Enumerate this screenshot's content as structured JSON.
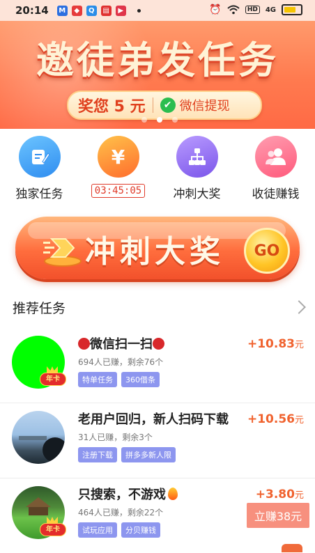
{
  "status_bar": {
    "time": "20:14",
    "network": "4G",
    "hd": "HD",
    "icons": [
      "app-m-icon",
      "app-red-icon",
      "app-q-icon",
      "app-news-icon",
      "app-video-icon",
      "alarm-icon",
      "wifi-icon",
      "battery-icon"
    ]
  },
  "banner": {
    "title": "邀徒弟发任务",
    "reward": "奖您 5 元",
    "wechat_label": "微信提现",
    "slide_index": 2,
    "slide_count": 3
  },
  "nav": {
    "items": [
      {
        "label": "独家任务",
        "icon": "edit-icon",
        "color": "#3fa6f5"
      },
      {
        "label": "03:45:05",
        "icon": "yuan-icon",
        "color": "#ff8a2a"
      },
      {
        "label": "冲刺大奖",
        "icon": "network-icon",
        "color": "#9b6cf5"
      },
      {
        "label": "收徒赚钱",
        "icon": "users-icon",
        "color": "#ff6f8a"
      }
    ]
  },
  "sprint": {
    "text": "冲刺大奖",
    "go_label": "GO"
  },
  "recommended": {
    "title": "推荐任务"
  },
  "tasks": [
    {
      "title": "微信扫一扫",
      "sub": "694人已赚，剩余76个",
      "tags": [
        "特单任务",
        "360借条"
      ],
      "price": "+10.83",
      "unit": "元",
      "badge": "年卡",
      "avatar_color": "#00ff00"
    },
    {
      "title": "老用户回归，新人扫码下载",
      "sub": "31人已赚，剩余3个",
      "tags": [
        "注册下载",
        "拼多多新人限"
      ],
      "price": "+10.56",
      "unit": "元",
      "badge": "",
      "avatar_color": "#8fb3d6"
    },
    {
      "title": "只搜索，不游戏",
      "sub": "464人已赚，剩余22个",
      "tags": [
        "试玩应用",
        "分贝赚钱"
      ],
      "price": "+3.80",
      "unit": "元",
      "badge": "年卡",
      "avatar_color": "#4cae3a"
    }
  ],
  "earn_button": "立赚38元"
}
